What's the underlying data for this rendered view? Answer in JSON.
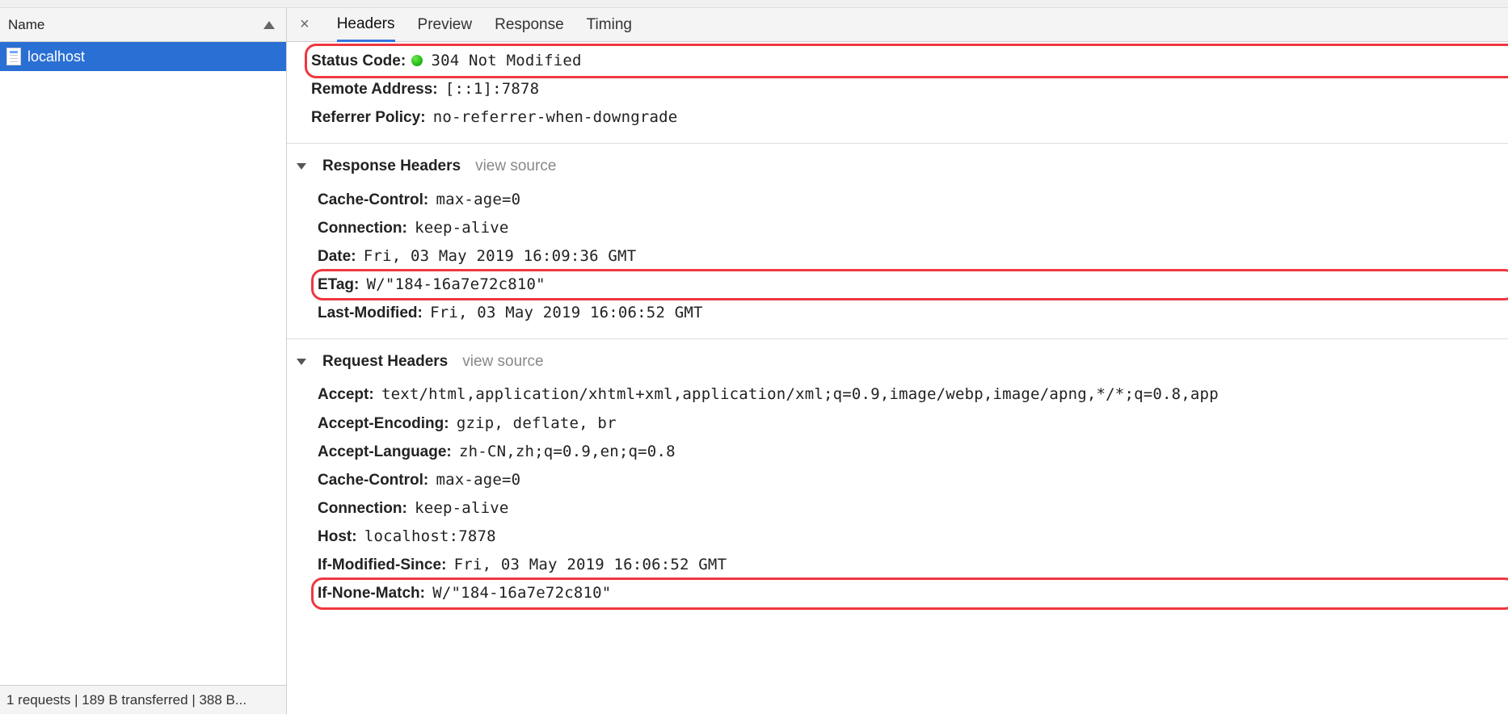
{
  "sidebar": {
    "column_header": "Name",
    "requests": [
      {
        "name": "localhost"
      }
    ],
    "status_text": "1 requests | 189 B transferred | 388 B..."
  },
  "tabs": {
    "headers": "Headers",
    "preview": "Preview",
    "response": "Response",
    "timing": "Timing"
  },
  "sections": {
    "general": [
      {
        "k": "Status Code",
        "v": "304 Not Modified",
        "status_dot": true
      },
      {
        "k": "Remote Address",
        "v": "[::1]:7878"
      },
      {
        "k": "Referrer Policy",
        "v": "no-referrer-when-downgrade"
      }
    ],
    "response_title": "Response Headers",
    "response": [
      {
        "k": "Cache-Control",
        "v": "max-age=0"
      },
      {
        "k": "Connection",
        "v": "keep-alive"
      },
      {
        "k": "Date",
        "v": "Fri, 03 May 2019 16:09:36 GMT"
      },
      {
        "k": "ETag",
        "v": "W/\"184-16a7e72c810\""
      },
      {
        "k": "Last-Modified",
        "v": "Fri, 03 May 2019 16:06:52 GMT"
      }
    ],
    "request_title": "Request Headers",
    "request": [
      {
        "k": "Accept",
        "v": "text/html,application/xhtml+xml,application/xml;q=0.9,image/webp,image/apng,*/*;q=0.8,app"
      },
      {
        "k": "Accept-Encoding",
        "v": "gzip, deflate, br"
      },
      {
        "k": "Accept-Language",
        "v": "zh-CN,zh;q=0.9,en;q=0.8"
      },
      {
        "k": "Cache-Control",
        "v": "max-age=0"
      },
      {
        "k": "Connection",
        "v": "keep-alive"
      },
      {
        "k": "Host",
        "v": "localhost:7878"
      },
      {
        "k": "If-Modified-Since",
        "v": "Fri, 03 May 2019 16:06:52 GMT"
      },
      {
        "k": "If-None-Match",
        "v": "W/\"184-16a7e72c810\""
      }
    ],
    "view_source": "view source"
  }
}
